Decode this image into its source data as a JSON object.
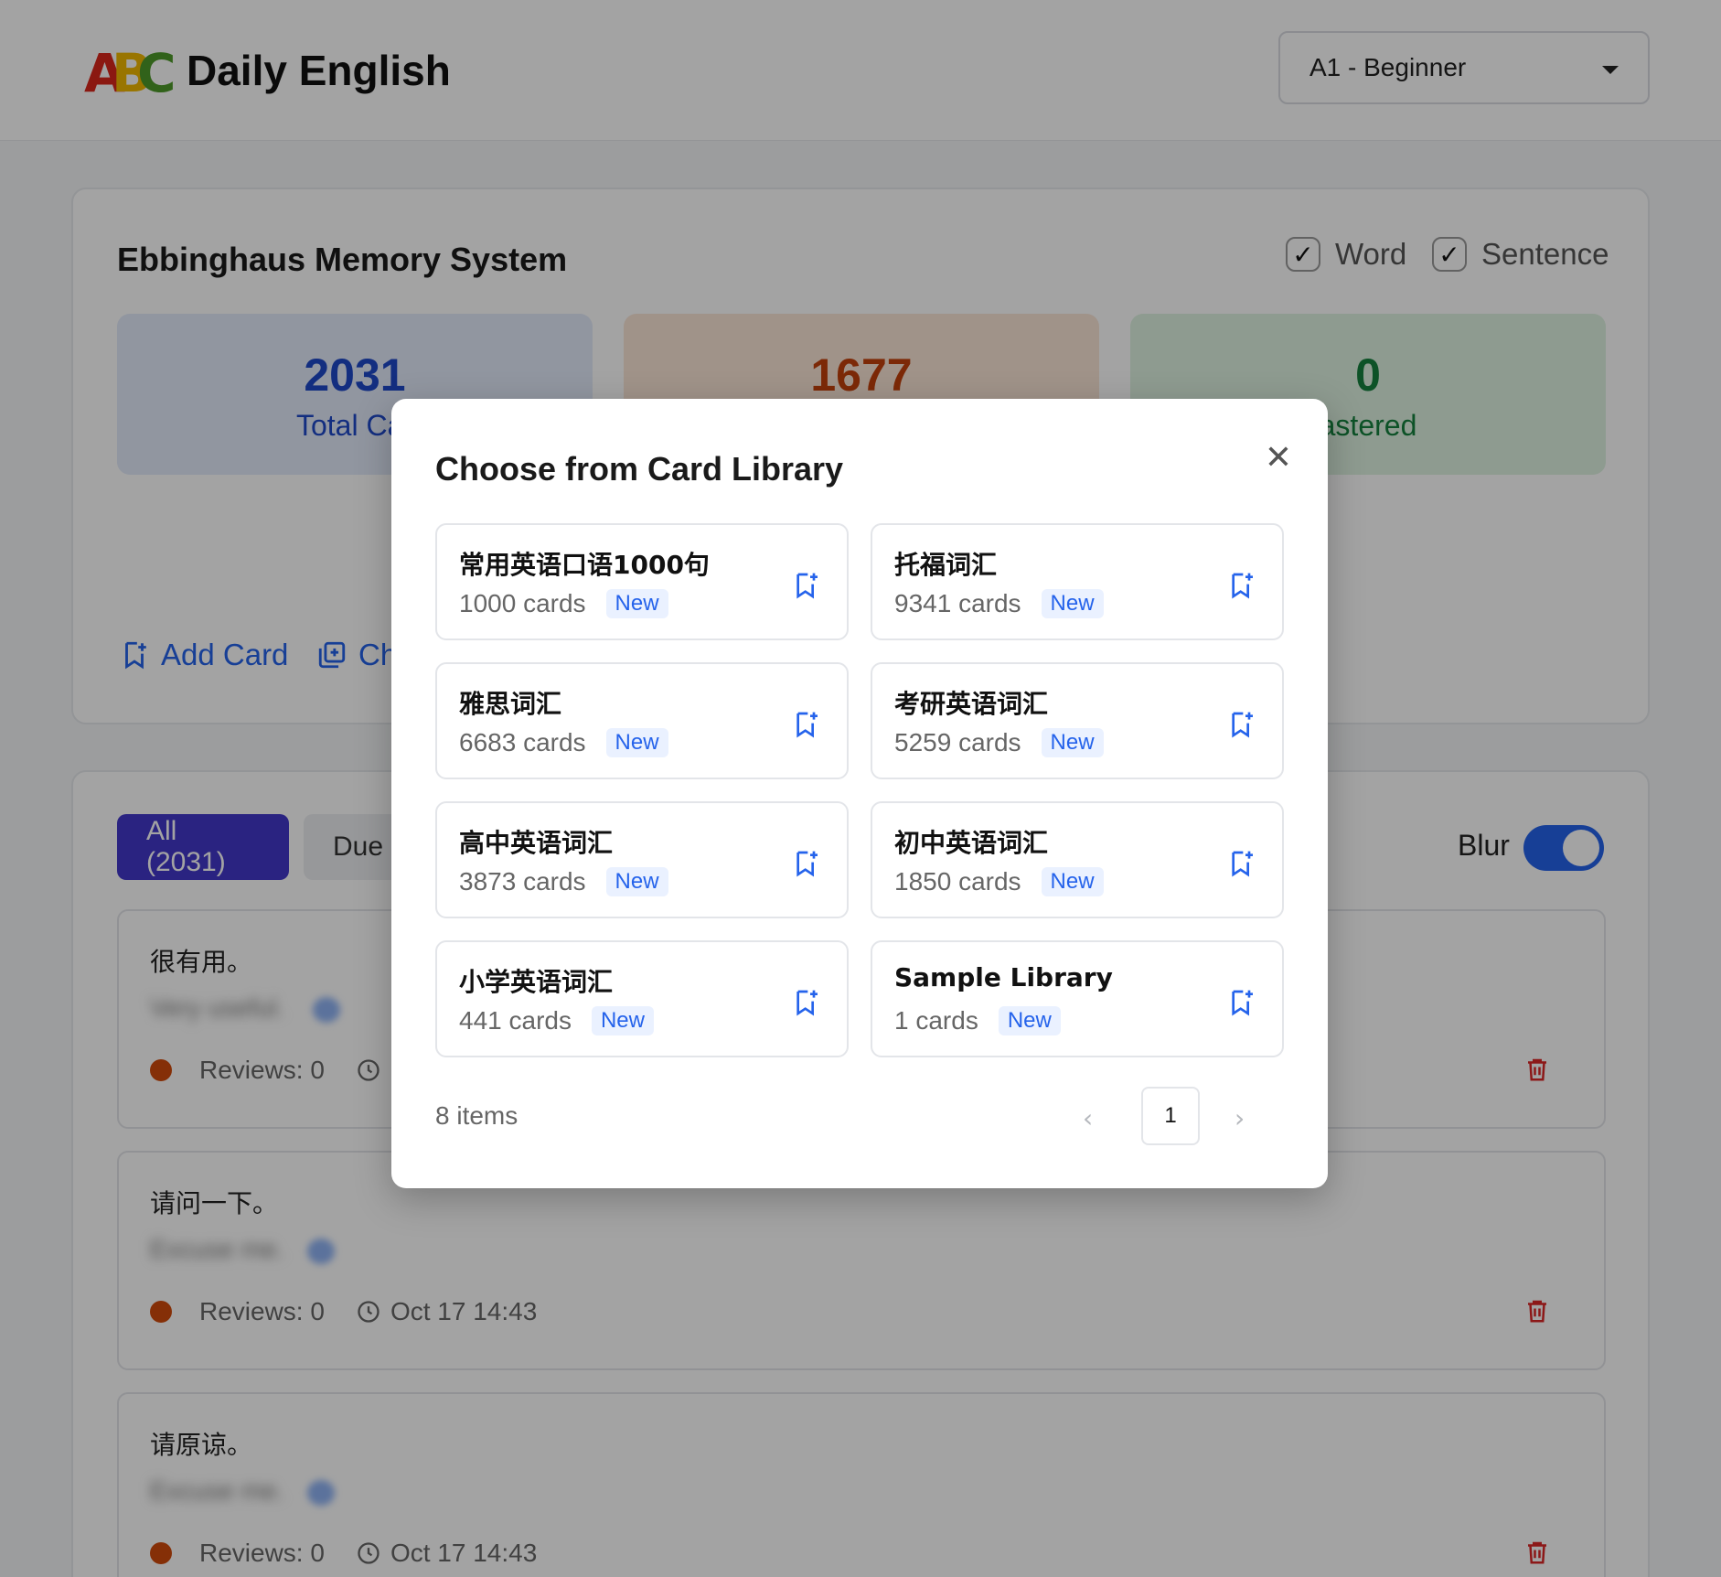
{
  "header": {
    "logo_letters": [
      "A",
      "B",
      "C"
    ],
    "title": "Daily English",
    "level_selected": "A1 - Beginner"
  },
  "stats_panel": {
    "title": "Ebbinghaus Memory System",
    "filters": [
      {
        "label": "Word",
        "checked": true
      },
      {
        "label": "Sentence",
        "checked": true
      }
    ],
    "stats": [
      {
        "value": "2031",
        "label": "Total Car"
      },
      {
        "value": "1677",
        "label": ""
      },
      {
        "value": "0",
        "label": "astered"
      }
    ],
    "actions": [
      {
        "label": "Add Card",
        "icon": "bookmark-plus-icon"
      },
      {
        "label": "Ch",
        "icon": "copy-plus-icon"
      }
    ]
  },
  "list_panel": {
    "tabs": [
      {
        "label": "All (2031)",
        "active": true
      },
      {
        "label": "Due (",
        "active": false
      }
    ],
    "blur_label": "Blur",
    "blur_on": true,
    "cards": [
      {
        "zh": "很有用。",
        "en": "Very useful.",
        "reviews": "Reviews: 0",
        "time": ""
      },
      {
        "zh": "请问一下。",
        "en": "Excuse me.",
        "reviews": "Reviews: 0",
        "time": "Oct 17 14:43"
      },
      {
        "zh": "请原谅。",
        "en": "Excuse me.",
        "reviews": "Reviews: 0",
        "time": "Oct 17 14:43"
      }
    ]
  },
  "modal": {
    "title": "Choose from Card Library",
    "close_icon": "close-icon",
    "libraries": [
      {
        "name": "常用英语口语1000句",
        "count": "1000 cards",
        "badge": "New"
      },
      {
        "name": "托福词汇",
        "count": "9341 cards",
        "badge": "New"
      },
      {
        "name": "雅思词汇",
        "count": "6683 cards",
        "badge": "New"
      },
      {
        "name": "考研英语词汇",
        "count": "5259 cards",
        "badge": "New"
      },
      {
        "name": "高中英语词汇",
        "count": "3873 cards",
        "badge": "New"
      },
      {
        "name": "初中英语词汇",
        "count": "1850 cards",
        "badge": "New"
      },
      {
        "name": "小学英语词汇",
        "count": "441 cards",
        "badge": "New"
      },
      {
        "name": "Sample Library",
        "count": "1 cards",
        "badge": "New"
      }
    ],
    "pagination": {
      "info": "8 items",
      "current": "1",
      "prev": "‹",
      "next": "›"
    }
  },
  "colors": {
    "accent": "#2563eb",
    "tab_active": "#4338ca",
    "due": "#c2410c",
    "mastered": "#15803d",
    "danger": "#dc2626"
  }
}
